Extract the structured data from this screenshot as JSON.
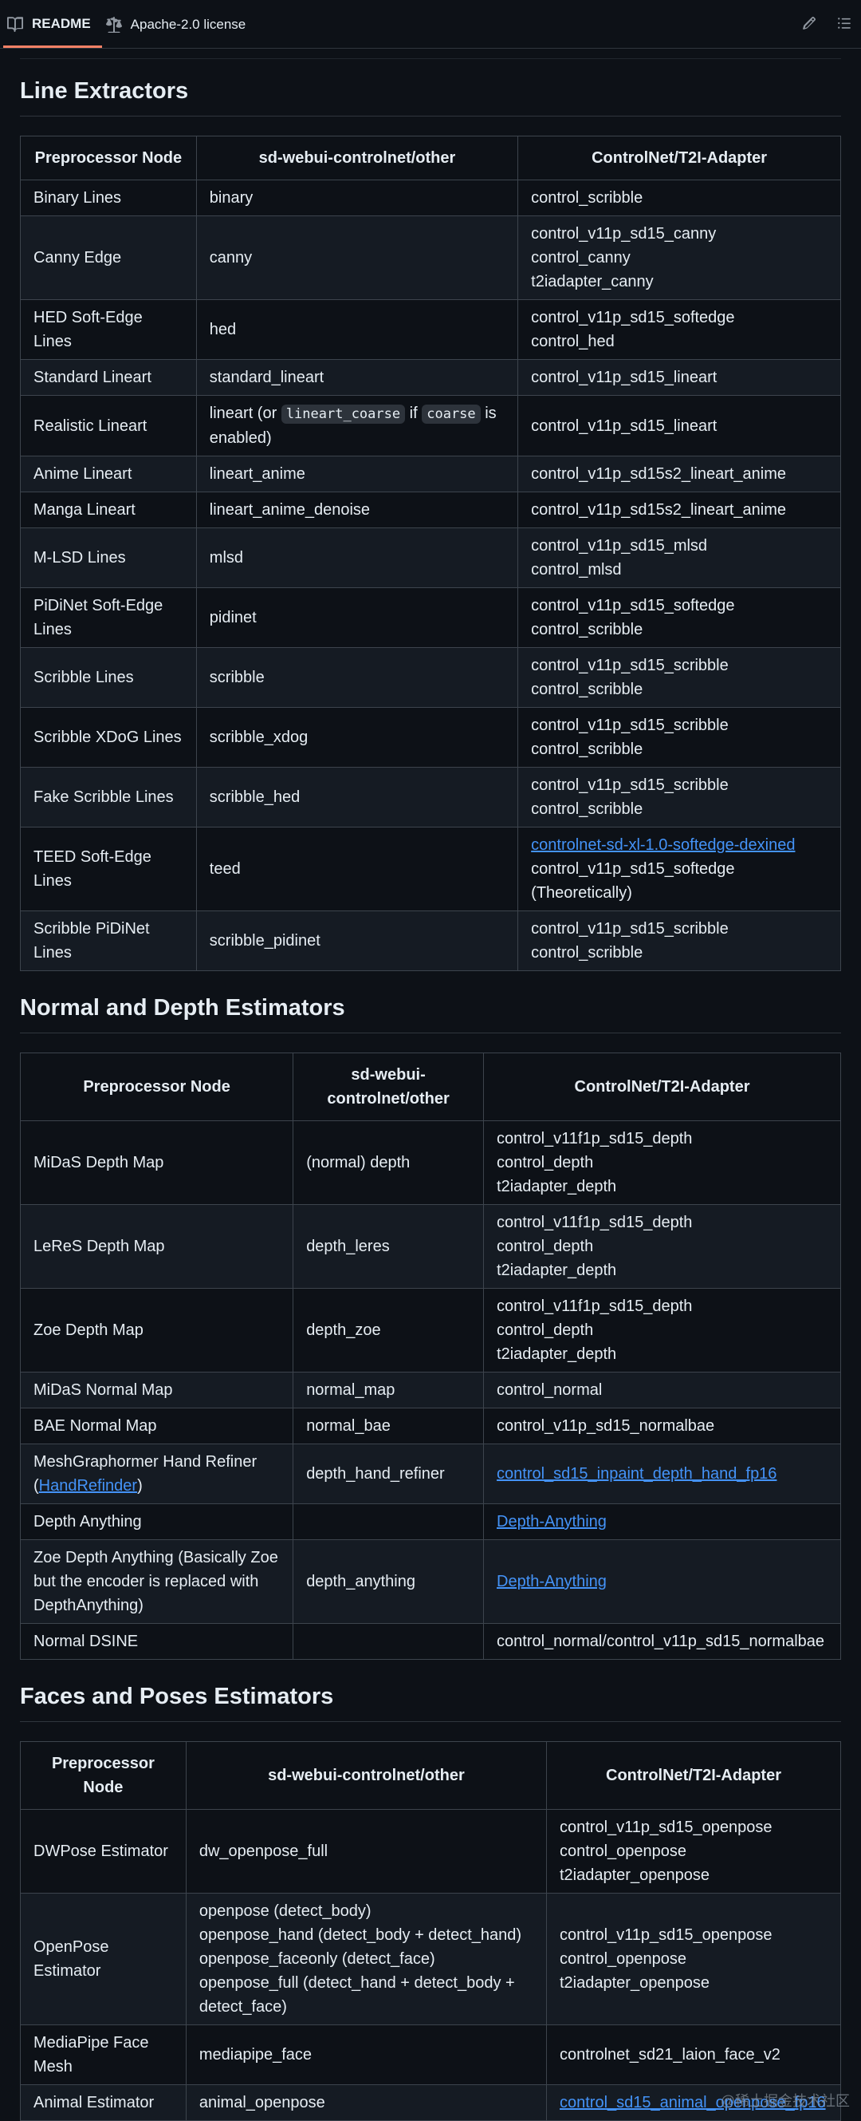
{
  "tabs": {
    "readme": "README",
    "license": "Apache-2.0 license"
  },
  "sections": [
    {
      "title": "Line Extractors",
      "headers": [
        "Preprocessor Node",
        "sd-webui-controlnet/other",
        "ControlNet/T2I-Adapter"
      ],
      "rows": [
        {
          "node": "Binary Lines",
          "other": "binary",
          "adapter": [
            "control_scribble"
          ]
        },
        {
          "node": "Canny Edge",
          "other": "canny",
          "adapter": [
            "control_v11p_sd15_canny",
            "control_canny",
            "t2iadapter_canny"
          ]
        },
        {
          "node": "HED Soft-Edge Lines",
          "other": "hed",
          "adapter": [
            "control_v11p_sd15_softedge",
            "control_hed"
          ]
        },
        {
          "node": "Standard Lineart",
          "other": "standard_lineart",
          "adapter": [
            "control_v11p_sd15_lineart"
          ]
        },
        {
          "node": "Realistic Lineart",
          "other_rich": true,
          "other_parts": [
            "lineart (or ",
            "lineart_coarse",
            " if ",
            "coarse",
            " is enabled)"
          ],
          "adapter": [
            "control_v11p_sd15_lineart"
          ]
        },
        {
          "node": "Anime Lineart",
          "other": "lineart_anime",
          "adapter": [
            "control_v11p_sd15s2_lineart_anime"
          ]
        },
        {
          "node": "Manga Lineart",
          "other": "lineart_anime_denoise",
          "adapter": [
            "control_v11p_sd15s2_lineart_anime"
          ]
        },
        {
          "node": "M-LSD Lines",
          "other": "mlsd",
          "adapter": [
            "control_v11p_sd15_mlsd",
            "control_mlsd"
          ]
        },
        {
          "node": "PiDiNet Soft-Edge Lines",
          "other": "pidinet",
          "adapter": [
            "control_v11p_sd15_softedge",
            "control_scribble"
          ]
        },
        {
          "node": "Scribble Lines",
          "other": "scribble",
          "adapter": [
            "control_v11p_sd15_scribble",
            "control_scribble"
          ]
        },
        {
          "node": "Scribble XDoG Lines",
          "other": "scribble_xdog",
          "adapter": [
            "control_v11p_sd15_scribble",
            "control_scribble"
          ]
        },
        {
          "node": "Fake Scribble Lines",
          "other": "scribble_hed",
          "adapter": [
            "control_v11p_sd15_scribble",
            "control_scribble"
          ]
        },
        {
          "node": "TEED Soft-Edge Lines",
          "other": "teed",
          "adapter_link": "controlnet-sd-xl-1.0-softedge-dexined",
          "adapter": [
            "control_v11p_sd15_softedge (Theoretically)"
          ]
        },
        {
          "node": "Scribble PiDiNet Lines",
          "other": "scribble_pidinet",
          "adapter": [
            "control_v11p_sd15_scribble",
            "control_scribble"
          ]
        }
      ]
    },
    {
      "title": "Normal and Depth Estimators",
      "headers": [
        "Preprocessor Node",
        "sd-webui-controlnet/other",
        "ControlNet/T2I-Adapter"
      ],
      "rows": [
        {
          "node": "MiDaS Depth Map",
          "other": "(normal) depth",
          "adapter": [
            "control_v11f1p_sd15_depth",
            "control_depth",
            "t2iadapter_depth"
          ]
        },
        {
          "node": "LeReS Depth Map",
          "other": "depth_leres",
          "adapter": [
            "control_v11f1p_sd15_depth",
            "control_depth",
            "t2iadapter_depth"
          ]
        },
        {
          "node": "Zoe Depth Map",
          "other": "depth_zoe",
          "adapter": [
            "control_v11f1p_sd15_depth",
            "control_depth",
            "t2iadapter_depth"
          ]
        },
        {
          "node": "MiDaS Normal Map",
          "other": "normal_map",
          "adapter": [
            "control_normal"
          ]
        },
        {
          "node": "BAE Normal Map",
          "other": "normal_bae",
          "adapter": [
            "control_v11p_sd15_normalbae"
          ]
        },
        {
          "node_rich": true,
          "node_parts": [
            "MeshGraphormer Hand Refiner (",
            "HandRefinder",
            ")"
          ],
          "other": "depth_hand_refiner",
          "adapter_link": "control_sd15_inpaint_depth_hand_fp16",
          "adapter": []
        },
        {
          "node": "Depth Anything",
          "other": "",
          "adapter_link": "Depth-Anything",
          "adapter": []
        },
        {
          "node": "Zoe Depth Anything (Basically Zoe but the encoder is replaced with DepthAnything)",
          "other": "depth_anything",
          "adapter_link": "Depth-Anything",
          "adapter": []
        },
        {
          "node": "Normal DSINE",
          "other": "",
          "adapter": [
            "control_normal/control_v11p_sd15_normalbae"
          ]
        }
      ]
    },
    {
      "title": "Faces and Poses Estimators",
      "headers": [
        "Preprocessor Node",
        "sd-webui-controlnet/other",
        "ControlNet/T2I-Adapter"
      ],
      "rows": [
        {
          "node": "DWPose Estimator",
          "other": "dw_openpose_full",
          "adapter": [
            "control_v11p_sd15_openpose",
            "control_openpose",
            "t2iadapter_openpose"
          ]
        },
        {
          "node": "OpenPose Estimator",
          "other_lines": [
            "openpose (detect_body)",
            "openpose_hand (detect_body + detect_hand)",
            "openpose_faceonly (detect_face)",
            "openpose_full (detect_hand + detect_body + detect_face)"
          ],
          "adapter": [
            "control_v11p_sd15_openpose",
            "control_openpose",
            "t2iadapter_openpose"
          ]
        },
        {
          "node": "MediaPipe Face Mesh",
          "other": "mediapipe_face",
          "adapter": [
            "controlnet_sd21_laion_face_v2"
          ]
        },
        {
          "node": "Animal Estimator",
          "other": "animal_openpose",
          "adapter_link": "control_sd15_animal_openpose_fp16",
          "adapter": []
        }
      ]
    }
  ],
  "watermark": "@稀土掘金技术社区",
  "icons": {
    "readme": "book-icon",
    "license": "scale-icon",
    "edit": "pencil-icon",
    "menu": "list-icon"
  },
  "colors": {
    "background": "#0d1117",
    "link": "#4493f8",
    "accent": "#f78166"
  }
}
